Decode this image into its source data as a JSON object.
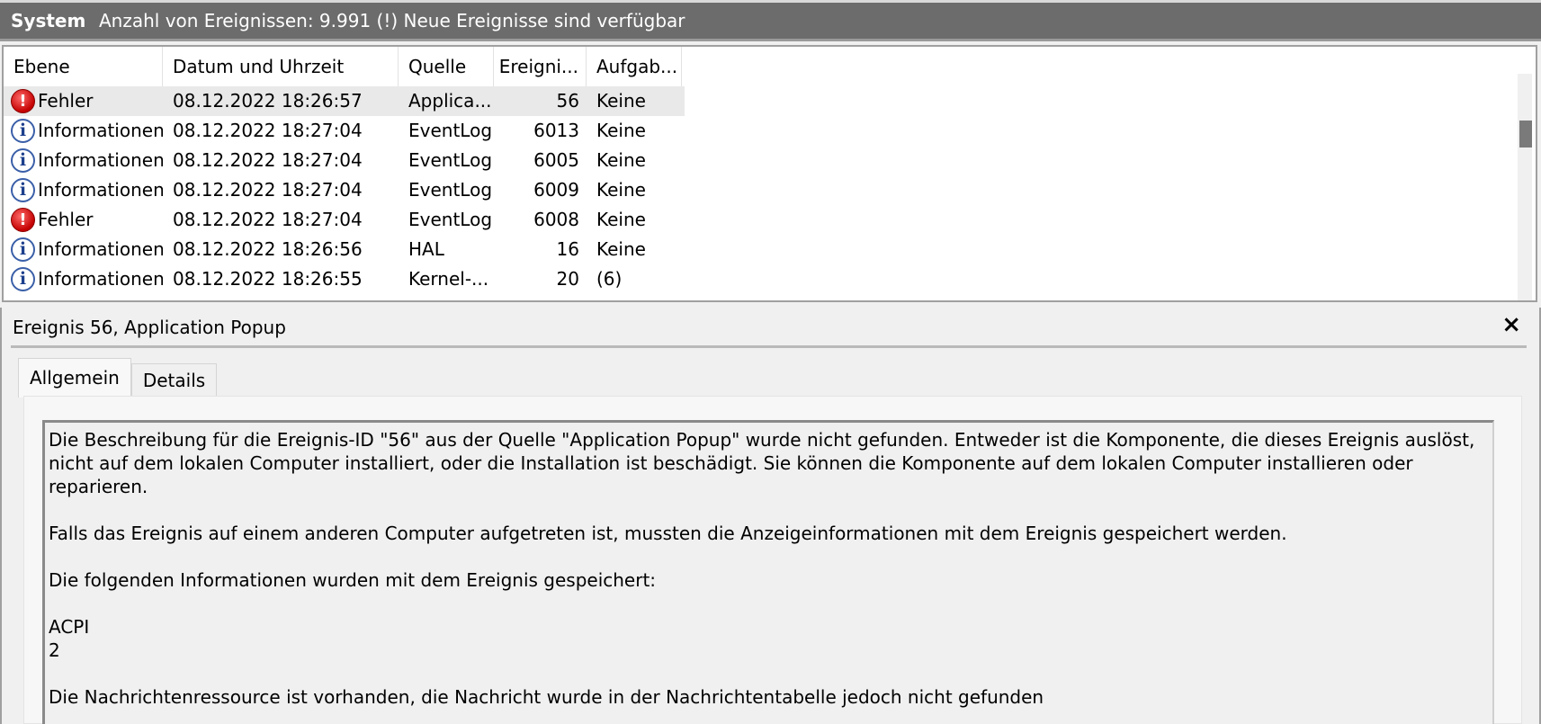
{
  "header": {
    "log_name": "System",
    "info": "Anzahl von Ereignissen: 9.991 (!) Neue Ereignisse sind verfügbar"
  },
  "columns": {
    "level": "Ebene",
    "date": "Datum und Uhrzeit",
    "source": "Quelle",
    "event_id": "Ereigni...",
    "task": "Aufgab..."
  },
  "rows": [
    {
      "level": "Fehler",
      "icon": "error-icon",
      "date": "08.12.2022 18:26:57",
      "source": "Applica...",
      "event_id": "56",
      "task": "Keine"
    },
    {
      "level": "Informationen",
      "icon": "info-icon",
      "date": "08.12.2022 18:27:04",
      "source": "EventLog",
      "event_id": "6013",
      "task": "Keine"
    },
    {
      "level": "Informationen",
      "icon": "info-icon",
      "date": "08.12.2022 18:27:04",
      "source": "EventLog",
      "event_id": "6005",
      "task": "Keine"
    },
    {
      "level": "Informationen",
      "icon": "info-icon",
      "date": "08.12.2022 18:27:04",
      "source": "EventLog",
      "event_id": "6009",
      "task": "Keine"
    },
    {
      "level": "Fehler",
      "icon": "error-icon",
      "date": "08.12.2022 18:27:04",
      "source": "EventLog",
      "event_id": "6008",
      "task": "Keine"
    },
    {
      "level": "Informationen",
      "icon": "info-icon",
      "date": "08.12.2022 18:26:56",
      "source": "HAL",
      "event_id": "16",
      "task": "Keine"
    },
    {
      "level": "Informationen",
      "icon": "info-icon",
      "date": "08.12.2022 18:26:55",
      "source": "Kernel-...",
      "event_id": "20",
      "task": "(6)"
    }
  ],
  "detail": {
    "title": "Ereignis 56, Application Popup",
    "close_glyph": "×",
    "tabs": {
      "general": "Allgemein",
      "details": "Details"
    },
    "description": [
      "Die Beschreibung für die Ereignis-ID \"56\" aus der Quelle \"Application Popup\" wurde nicht gefunden. Entweder ist die Komponente, die dieses Ereignis auslöst, nicht auf dem lokalen Computer installiert, oder die Installation ist beschädigt. Sie können die Komponente auf dem lokalen Computer installieren oder reparieren.",
      "",
      "Falls das Ereignis auf einem anderen Computer aufgetreten ist, mussten die Anzeigeinformationen mit dem Ereignis gespeichert werden.",
      "",
      "Die folgenden Informationen wurden mit dem Ereignis gespeichert:",
      "",
      "ACPI",
      "2",
      "",
      "Die Nachrichtenressource ist vorhanden, die Nachricht wurde in der Nachrichtentabelle jedoch nicht gefunden"
    ]
  },
  "colors": {
    "header_bg": "#6c6c6c",
    "error": "#c40000",
    "info": "#1d3f8c",
    "selected_row": "#e9e9e9"
  }
}
